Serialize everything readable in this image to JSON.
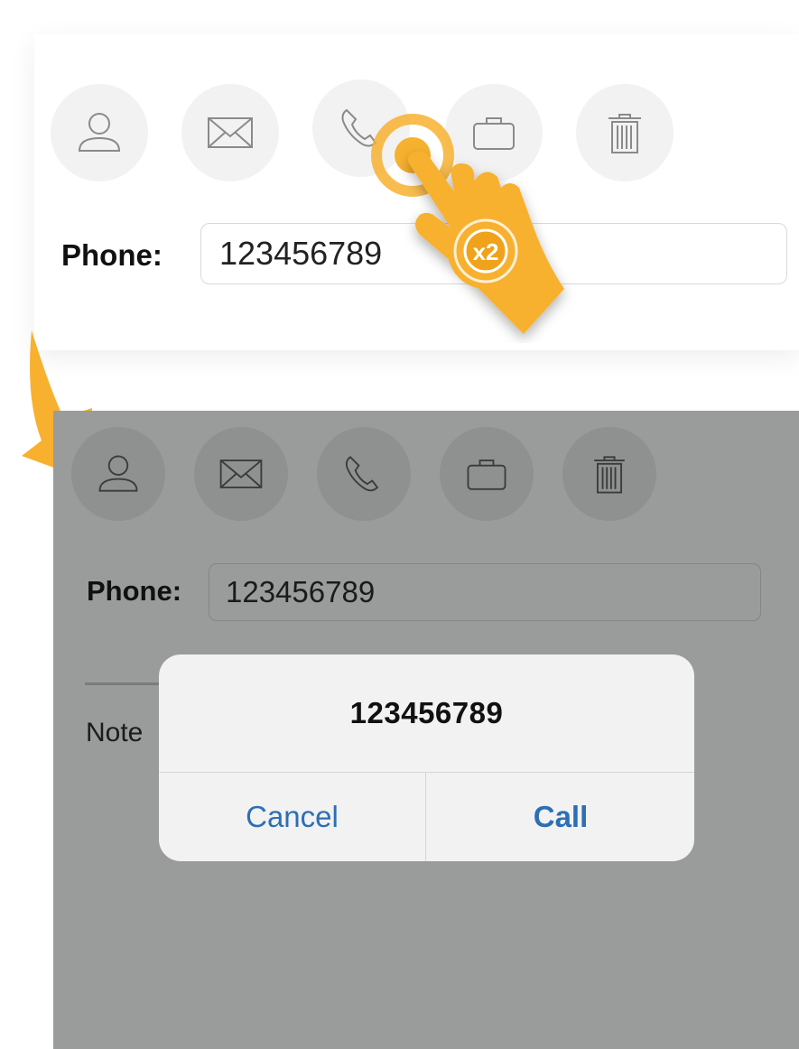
{
  "top": {
    "icons": [
      "person-icon",
      "envelope-icon",
      "phone-icon",
      "briefcase-icon",
      "trash-icon"
    ],
    "phone_label": "Phone:",
    "phone_value": "123456789",
    "tap_badge": "x2"
  },
  "bottom": {
    "icons": [
      "person-icon",
      "envelope-icon",
      "phone-icon",
      "briefcase-icon",
      "trash-icon"
    ],
    "phone_label": "Phone:",
    "phone_value": "123456789",
    "notes_label": "Note"
  },
  "dialog": {
    "title": "123456789",
    "cancel_label": "Cancel",
    "call_label": "Call"
  },
  "colors": {
    "accent": "#f7b12f",
    "dim_overlay": "#9a9b9b",
    "dialog_link": "#2d6fb5"
  }
}
